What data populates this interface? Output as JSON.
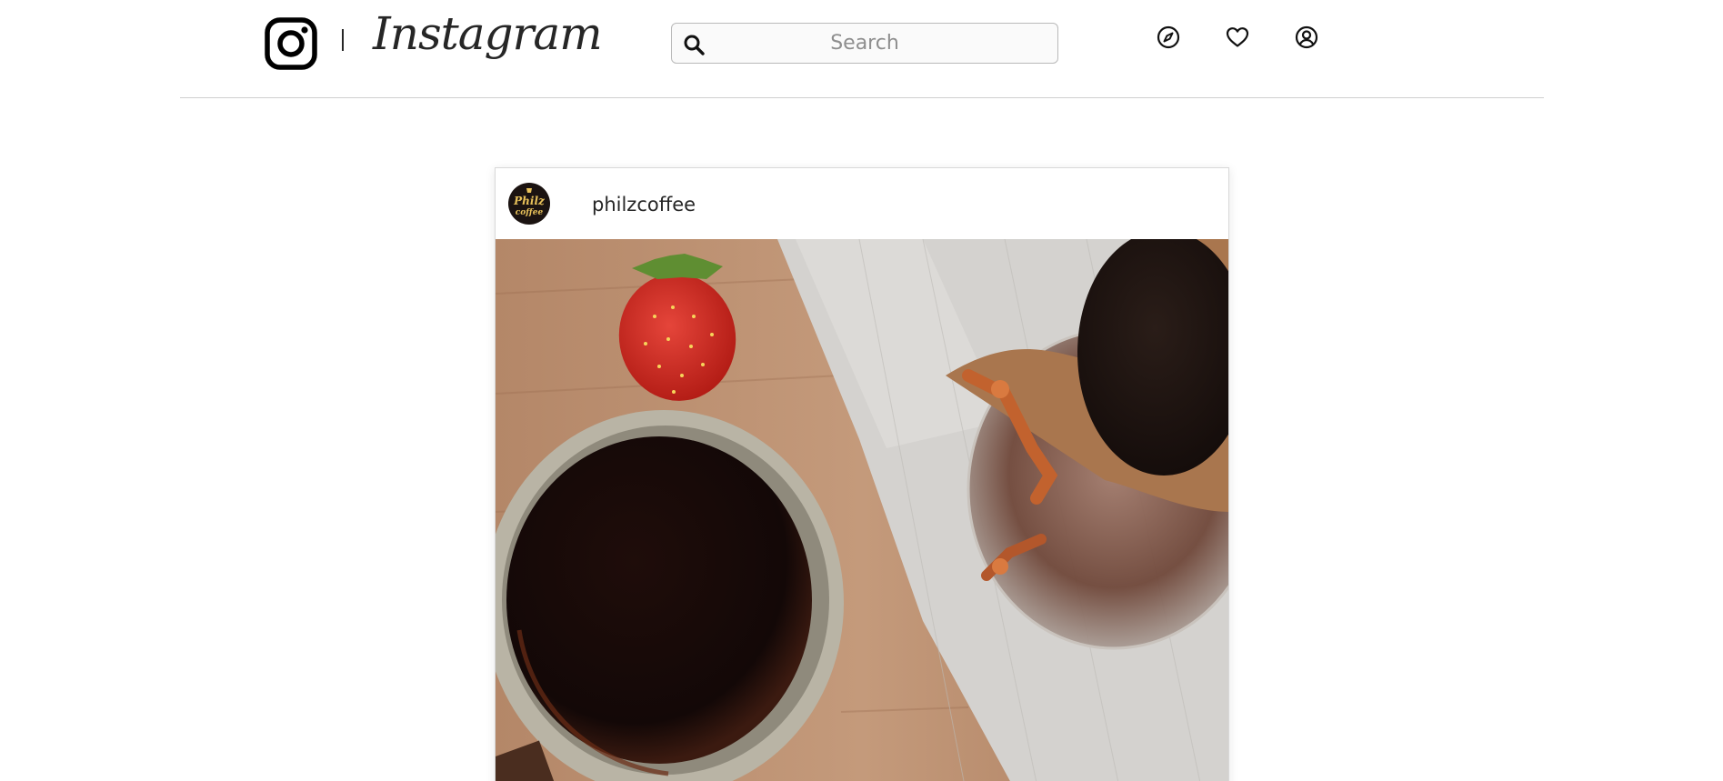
{
  "header": {
    "logo_text": "Instagram",
    "search": {
      "placeholder": "Search",
      "value": ""
    },
    "nav": [
      {
        "name": "explore",
        "icon": "compass-icon"
      },
      {
        "name": "activity",
        "icon": "heart-icon"
      },
      {
        "name": "profile",
        "icon": "user-circle-icon"
      }
    ]
  },
  "post": {
    "username": "philzcoffee",
    "avatar_text": "Philz Coffee",
    "image": {
      "subject": "coffee cup, strawberry and pour-over carafe on wooden table"
    }
  },
  "colors": {
    "text": "#262626",
    "border": "#d8d8d8",
    "placeholder": "#8e8e8e",
    "avatar_bg": "#1b1311",
    "avatar_letters": "#e9c25a"
  }
}
